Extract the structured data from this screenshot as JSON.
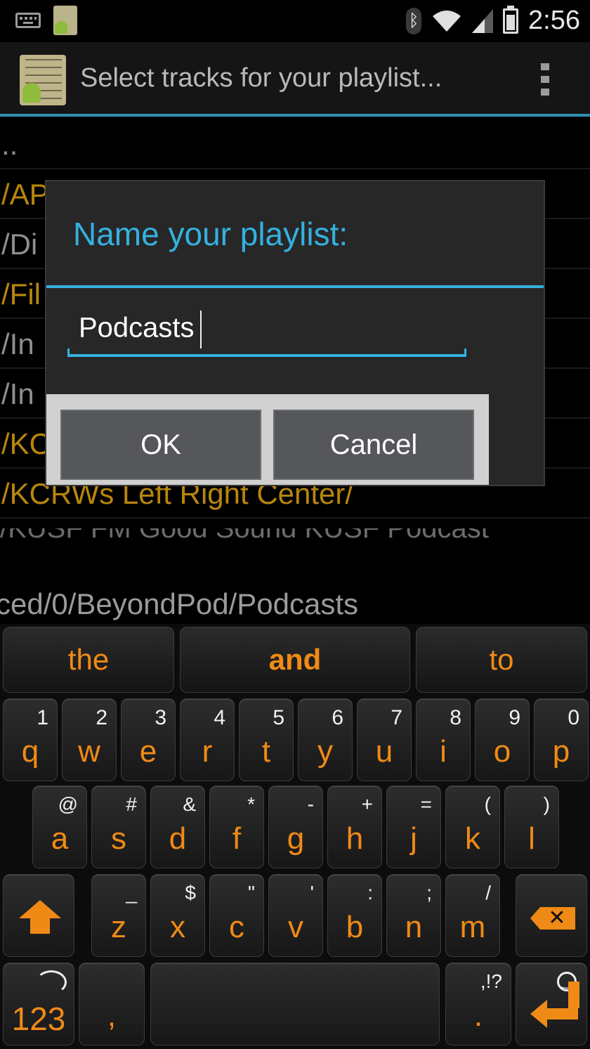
{
  "status_bar": {
    "time": "2:56",
    "icons": [
      "keyboard-icon",
      "app-notification-icon",
      "bluetooth-icon",
      "wifi-icon",
      "signal-icon",
      "battery-icon"
    ]
  },
  "action_bar": {
    "title": "Select tracks for your playlist...",
    "icon": "playlist-app-icon",
    "overflow_icon": "overflow-menu-icon"
  },
  "file_list": {
    "rows": [
      {
        "text": "..",
        "color": "#8e8e8e"
      },
      {
        "text": "/AP",
        "color": "#b8860b"
      },
      {
        "text": "/Di",
        "color": "#8e8e8e"
      },
      {
        "text": "/Fil",
        "color": "#b8860b"
      },
      {
        "text": "/In",
        "color": "#8e8e8e"
      },
      {
        "text": "/In",
        "color": "#8e8e8e"
      },
      {
        "text": "/KC",
        "color": "#b8860b"
      },
      {
        "text": "/KCRWs Left Right  Center/",
        "color": "#b8860b"
      }
    ],
    "path": "ced/0/BeyondPod/Podcasts"
  },
  "dialog": {
    "title": "Name your playlist:",
    "input_value": "Podcasts",
    "ok_label": "OK",
    "cancel_label": "Cancel"
  },
  "keyboard": {
    "accent": "#f08a16",
    "suggestions": [
      "the",
      "and",
      "to"
    ],
    "row1": [
      {
        "main": "q",
        "sec": "1"
      },
      {
        "main": "w",
        "sec": "2"
      },
      {
        "main": "e",
        "sec": "3"
      },
      {
        "main": "r",
        "sec": "4"
      },
      {
        "main": "t",
        "sec": "5"
      },
      {
        "main": "y",
        "sec": "6"
      },
      {
        "main": "u",
        "sec": "7"
      },
      {
        "main": "i",
        "sec": "8"
      },
      {
        "main": "o",
        "sec": "9"
      },
      {
        "main": "p",
        "sec": "0"
      }
    ],
    "row2": [
      {
        "main": "a",
        "sec": "@"
      },
      {
        "main": "s",
        "sec": "#"
      },
      {
        "main": "d",
        "sec": "&"
      },
      {
        "main": "f",
        "sec": "*"
      },
      {
        "main": "g",
        "sec": "-"
      },
      {
        "main": "h",
        "sec": "+"
      },
      {
        "main": "j",
        "sec": "="
      },
      {
        "main": "k",
        "sec": "("
      },
      {
        "main": "l",
        "sec": ")"
      }
    ],
    "row3": [
      {
        "main": "z",
        "sec": "_"
      },
      {
        "main": "x",
        "sec": "$"
      },
      {
        "main": "c",
        "sec": "\""
      },
      {
        "main": "v",
        "sec": "'"
      },
      {
        "main": "b",
        "sec": ":"
      },
      {
        "main": "n",
        "sec": ";"
      },
      {
        "main": "m",
        "sec": "/"
      }
    ],
    "num_label": "123",
    "comma_label": ",",
    "period_label": ".",
    "period_sec": ",!?"
  }
}
